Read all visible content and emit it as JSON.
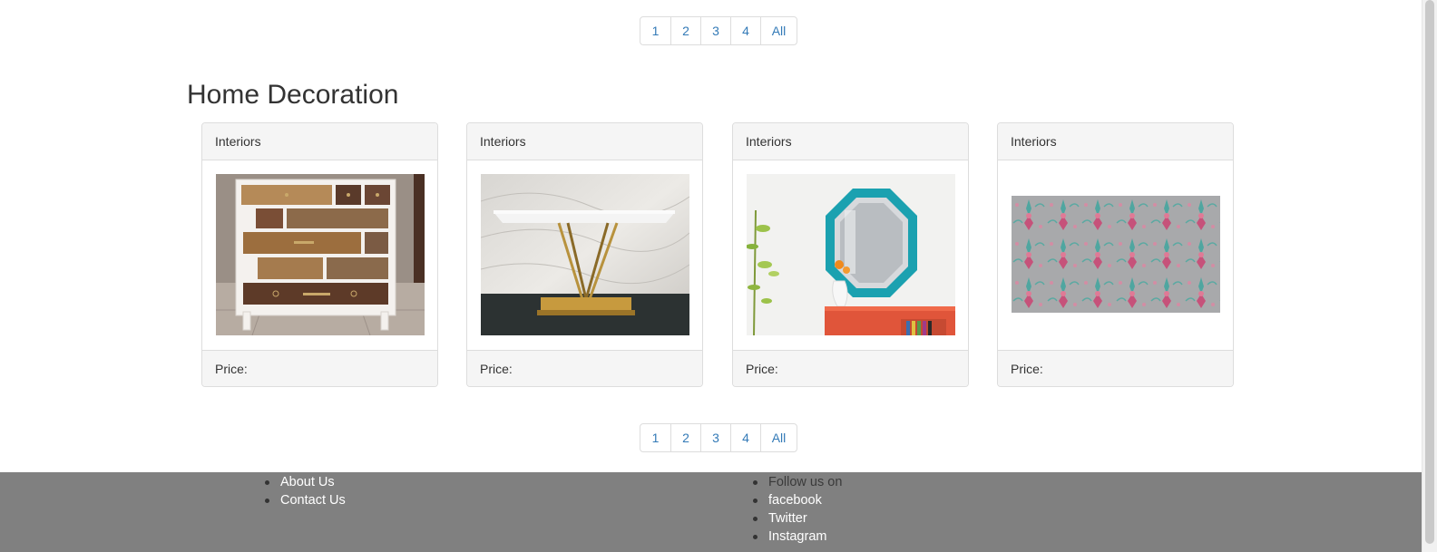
{
  "pagination": {
    "pages": [
      "1",
      "2",
      "3",
      "4"
    ],
    "all_label": "All"
  },
  "section": {
    "title": "Home Decoration"
  },
  "products": [
    {
      "category": "Interiors",
      "price_label": "Price:",
      "image": "chest-of-drawers"
    },
    {
      "category": "Interiors",
      "price_label": "Price:",
      "image": "console-table"
    },
    {
      "category": "Interiors",
      "price_label": "Price:",
      "image": "octagonal-mirror"
    },
    {
      "category": "Interiors",
      "price_label": "Price:",
      "image": "patterned-wallpaper"
    }
  ],
  "footer": {
    "links_left": [
      "About Us",
      "Contact Us"
    ],
    "follow_label": "Follow us on",
    "social": [
      "facebook",
      "Twitter",
      "Instagram"
    ]
  },
  "colors": {
    "link": "#337ab7",
    "footer_bg": "#808080",
    "card_header_bg": "#f5f5f5"
  }
}
